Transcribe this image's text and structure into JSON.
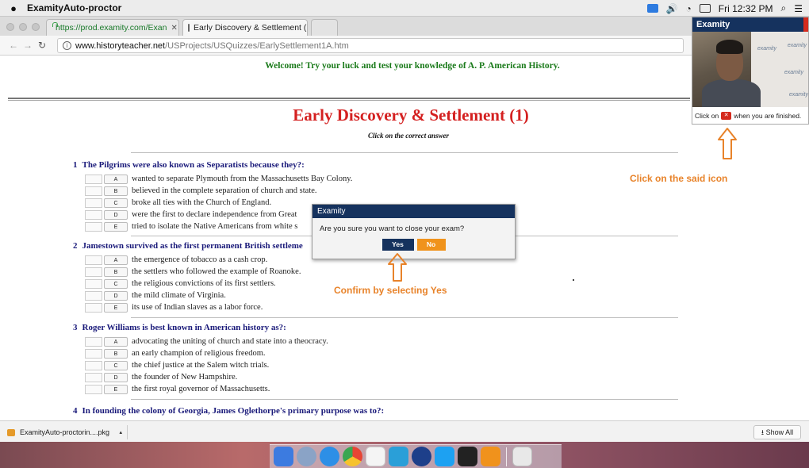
{
  "menubar": {
    "app_name": "ExamityAuto-proctor",
    "clock": "Fri 12:32 PM",
    "apple_glyph": "",
    "icons": [
      "examity-icon",
      "volume-icon",
      "wifi-icon",
      "battery-icon",
      "search-icon",
      "list-icon"
    ]
  },
  "browser": {
    "tabs": [
      {
        "label": "https://prod.examity.com/Exan",
        "icon": "lock-icon"
      },
      {
        "label": "Early Discovery & Settlement (",
        "icon": "page-icon"
      }
    ],
    "url": "www.historyteacher.net/USProjects/USQuizzes/EarlySettlement1A.htm",
    "url_host": "www.historyteacher.net",
    "url_path": "/USProjects/USQuizzes/EarlySettlement1A.htm"
  },
  "page": {
    "welcome": "Welcome! Try your luck and test your knowledge of A. P. American History.",
    "title": "Early Discovery & Settlement (1)",
    "subtitle": "Click on the correct answer"
  },
  "questions": [
    {
      "number": "1",
      "text": "The Pilgrims were also known as Separatists because they?:",
      "answers": [
        {
          "letter": "A",
          "text": "wanted to separate Plymouth from the Massachusetts Bay Colony."
        },
        {
          "letter": "B",
          "text": "believed in the complete separation of church and state."
        },
        {
          "letter": "C",
          "text": "broke all ties with the Church of England."
        },
        {
          "letter": "D",
          "text": "were the first to declare independence from Great"
        },
        {
          "letter": "E",
          "text": "tried to isolate the Native Americans from white s"
        }
      ]
    },
    {
      "number": "2",
      "text": "Jamestown survived as the first permanent British settleme",
      "answers": [
        {
          "letter": "A",
          "text": "the emergence of tobacco as a cash crop."
        },
        {
          "letter": "B",
          "text": "the settlers who followed the example of Roanoke."
        },
        {
          "letter": "C",
          "text": "the religious convictions of its first settlers."
        },
        {
          "letter": "D",
          "text": "the mild climate of Virginia."
        },
        {
          "letter": "E",
          "text": "its use of Indian slaves as a labor force."
        }
      ]
    },
    {
      "number": "3",
      "text": "Roger Williams is best known in American history as?:",
      "answers": [
        {
          "letter": "A",
          "text": "advocating the uniting of church and state into a theocracy."
        },
        {
          "letter": "B",
          "text": "an early champion of religious freedom."
        },
        {
          "letter": "C",
          "text": "the chief justice at the Salem witch trials."
        },
        {
          "letter": "D",
          "text": "the founder of New Hampshire."
        },
        {
          "letter": "E",
          "text": "the first royal governor of Massachusetts."
        }
      ]
    },
    {
      "number": "4",
      "text": "In founding the colony of Georgia, James Oglethorpe's primary purpose was to?:",
      "answers": []
    }
  ],
  "examity_panel": {
    "title": "Examity",
    "footer_prefix": "Click on",
    "footer_suffix": "when you are finished.",
    "watermark": "examity"
  },
  "dialog": {
    "title": "Examity",
    "message": "Are you sure you want to close your exam?",
    "yes_label": "Yes",
    "no_label": "No"
  },
  "annotations": {
    "icon_note": "Click on the said icon",
    "confirm_note": "Confirm by selecting Yes",
    "color": "#e8832a"
  },
  "downloads": {
    "item": "ExamityAuto-proctorin....pkg",
    "show_all": "Show All"
  },
  "colors": {
    "examity_navy": "#15325e",
    "no_orange": "#f0931c",
    "title_red": "#d42020",
    "welcome_green": "#1a7a1a",
    "question_navy": "#1a1a7a"
  }
}
